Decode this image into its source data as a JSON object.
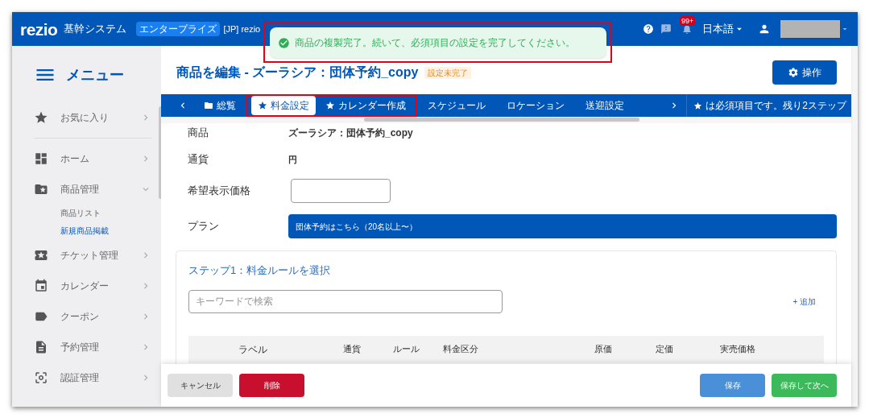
{
  "header": {
    "logo": "rezio",
    "system": "基幹システム",
    "plan_badge": "エンタープライズ",
    "workspace": "[JP] rezio",
    "notification_count": "99+",
    "language": "日本語"
  },
  "toast": {
    "message": "商品の複製完了。続いて、必須項目の設定を完了してください。",
    "highlighted": true
  },
  "sidebar": {
    "title": "メニュー",
    "items": [
      {
        "label": "お気に入り",
        "kind": "star",
        "expanded": false
      },
      {
        "label": "ホーム",
        "kind": "dashboard",
        "expanded": false
      },
      {
        "label": "商品管理",
        "kind": "folder",
        "expanded": true,
        "children": [
          {
            "label": "商品リスト",
            "selected": false
          },
          {
            "label": "新規商品掲載",
            "selected": true
          }
        ]
      },
      {
        "label": "チケット管理",
        "kind": "ticket",
        "expanded": false
      },
      {
        "label": "カレンダー",
        "kind": "calendar",
        "expanded": false
      },
      {
        "label": "クーポン",
        "kind": "tag",
        "expanded": false
      },
      {
        "label": "予約管理",
        "kind": "document",
        "expanded": false
      },
      {
        "label": "認証管理",
        "kind": "scan",
        "expanded": false
      }
    ]
  },
  "page": {
    "title": "商品を編集 - ズーラシア：団体予約_copy",
    "status": "設定未完了",
    "action_button": "操作"
  },
  "tabs": [
    {
      "label": "総覧",
      "kind": "folder",
      "selected": false,
      "highlighted": false
    },
    {
      "label": "料金設定",
      "kind": "required",
      "selected": true,
      "highlighted": true
    },
    {
      "label": "カレンダー作成",
      "kind": "required",
      "selected": false,
      "highlighted": true
    },
    {
      "label": "スケジュール",
      "kind": "plain",
      "selected": false,
      "highlighted": false
    },
    {
      "label": "ロケーション",
      "kind": "plain",
      "selected": false,
      "highlighted": false
    },
    {
      "label": "送迎設定",
      "kind": "plain",
      "selected": false,
      "highlighted": false
    }
  ],
  "required_note": "は必須項目です。残り2ステップ",
  "form": {
    "product_label": "商品",
    "product": "ズーラシア：団体予約_copy",
    "currency_label": "通貨",
    "currency": "円",
    "display_price_label": "希望表示価格",
    "plan_label": "プラン",
    "plan": "団体予約はこちら（20名以上〜）"
  },
  "step": {
    "title": "ステップ1：料金ルールを選択",
    "search_placeholder": "キーワードで検索",
    "add_link": "+ 追加",
    "columns": [
      "ラベル",
      "通貨",
      "ルール",
      "料金区分",
      "原価",
      "定価",
      "実売価格"
    ]
  },
  "footer": {
    "cancel": "キャンセル",
    "delete": "削除",
    "save": "保存",
    "save_next": "保存して次へ"
  }
}
